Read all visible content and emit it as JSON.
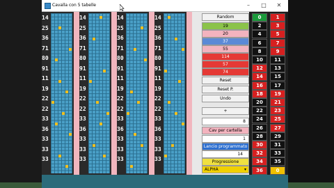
{
  "window": {
    "title": "Cavalla con 5 tabelle",
    "minimize": "–",
    "maximize": "□",
    "close": "✕"
  },
  "panels": [
    {
      "numbers": [
        "14",
        "25",
        "36",
        "71",
        "80",
        "91",
        "11",
        "19",
        "22",
        "22",
        "33",
        "36",
        "33",
        "33",
        "33"
      ]
    },
    {
      "numbers": [
        "14",
        "25",
        "36",
        "71",
        "80",
        "91",
        "11",
        "19",
        "22",
        "22",
        "33",
        "36",
        "33",
        "33",
        "33"
      ]
    },
    {
      "numbers": [
        "14",
        "25",
        "36",
        "71",
        "80",
        "91",
        "11",
        "19",
        "22",
        "22",
        "33",
        "36",
        "33",
        "33",
        "33"
      ]
    },
    {
      "numbers": [
        "14",
        "25",
        "36",
        "71",
        "80",
        "91",
        "11",
        "19",
        "22",
        "22",
        "33",
        "36",
        "33",
        "33",
        "33"
      ]
    }
  ],
  "controls": {
    "random": "Random",
    "values": [
      "19",
      "20",
      "37",
      "55",
      "114",
      "57",
      "74"
    ],
    "value_colors": [
      "#8bc34a",
      "#f3b3be",
      "#5b8ad6",
      "#f3b3be",
      "#e53935",
      "#e53935",
      "#e53935"
    ],
    "reset": "Reset",
    "reset_p": "Reset P.",
    "undo": "Undo",
    "plus": "+",
    "counter": "8",
    "cav_label": "Cav per cartella",
    "cav_value": "1",
    "progress_label": "Lancio programmato",
    "progress_value": "14",
    "progression": "Progressione",
    "mode": "ALPHA"
  },
  "number_grid": [
    {
      "left": "0",
      "right": "1"
    },
    {
      "left": "2",
      "right": "3"
    },
    {
      "left": "4",
      "right": "5"
    },
    {
      "left": "6",
      "right": "7"
    },
    {
      "left": "8",
      "right": "9"
    },
    {
      "left": "10",
      "right": "11"
    },
    {
      "left": "12",
      "right": "13"
    },
    {
      "left": "14",
      "right": "15"
    },
    {
      "left": "16",
      "right": "17"
    },
    {
      "left": "18",
      "right": "19"
    },
    {
      "left": "20",
      "right": "21"
    },
    {
      "left": "22",
      "right": "23"
    },
    {
      "left": "24",
      "right": "25"
    },
    {
      "left": "26",
      "right": "27"
    },
    {
      "left": "28",
      "right": "29"
    },
    {
      "left": "30",
      "right": "31"
    },
    {
      "left": "32",
      "right": "33"
    },
    {
      "left": "34",
      "right": "35"
    },
    {
      "left": "36",
      "right": "0"
    }
  ]
}
